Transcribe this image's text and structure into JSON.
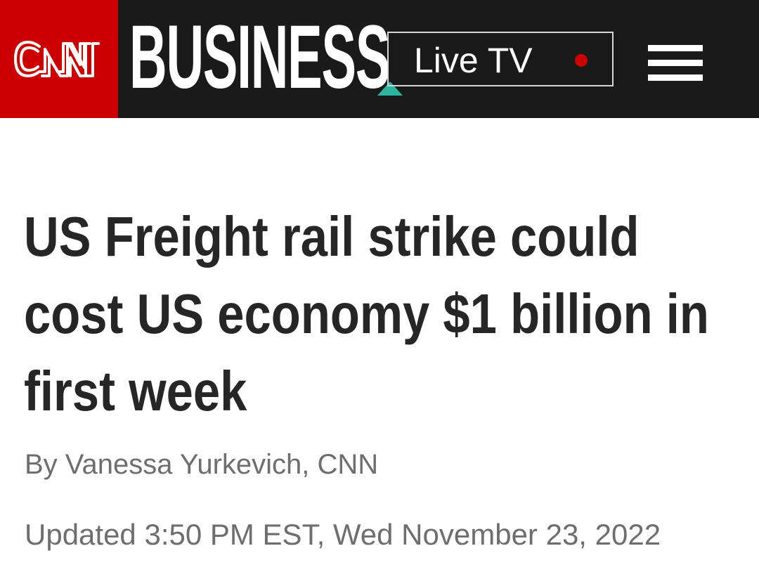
{
  "header": {
    "logo_text": "CNN",
    "section": "BUSINESS",
    "live_tv_label": "Live TV",
    "menu_icon": "hamburger-menu-icon",
    "live_indicator_icon": "live-dot-icon"
  },
  "article": {
    "headline": "US Freight rail strike could cost US economy $1 billion in first week",
    "byline": "By Vanessa Yurkevich, CNN",
    "timestamp": "Updated 3:50 PM EST, Wed November 23, 2022"
  },
  "colors": {
    "brand_red": "#cc0000",
    "header_bg": "#1a1a1a",
    "accent_teal": "#2bb5a0",
    "headline_text": "#262626",
    "meta_text": "#6e6e6e"
  }
}
